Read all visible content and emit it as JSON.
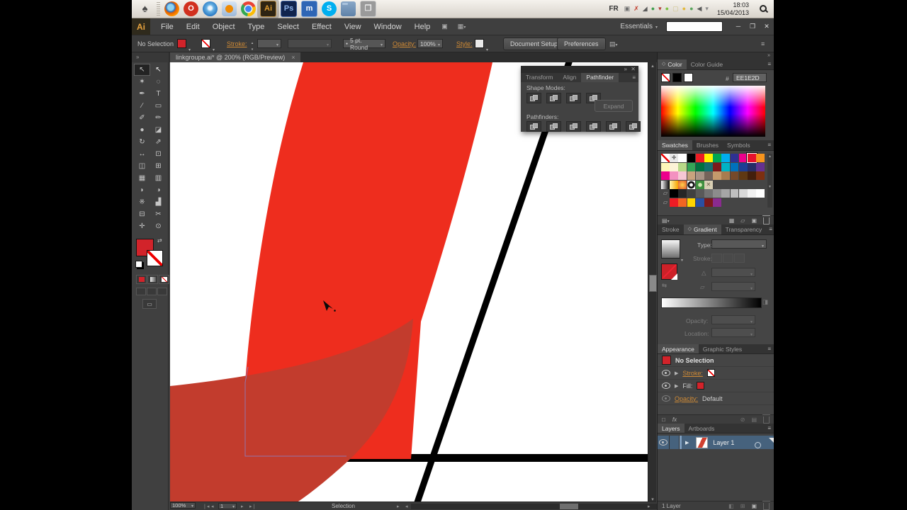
{
  "taskbar": {
    "language": "FR",
    "time": "18:03",
    "date": "15/04/2013",
    "apps": [
      {
        "name": "apple-menu-icon",
        "kind": "glyph",
        "label": "♠",
        "fg": "#4a4a4a"
      },
      {
        "name": "dock-separator",
        "kind": "sep"
      },
      {
        "name": "firefox-icon",
        "kind": "firefox"
      },
      {
        "name": "opera-icon",
        "kind": "opera",
        "label": "O",
        "fg": "#ffffff"
      },
      {
        "name": "safari-icon",
        "kind": "safari"
      },
      {
        "name": "media-player-icon",
        "kind": "player"
      },
      {
        "name": "chrome-icon",
        "kind": "chrome"
      },
      {
        "name": "illustrator-icon",
        "kind": "tile",
        "bg": "#2e2413",
        "border": "#b78a3e",
        "label": "Ai",
        "fg": "#e09c2f",
        "active": true
      },
      {
        "name": "photoshop-icon",
        "kind": "tile",
        "bg": "#11244d",
        "border": "#3e5f9e",
        "label": "Ps",
        "fg": "#8fb3e8"
      },
      {
        "name": "maxthon-icon",
        "kind": "tile",
        "bg": "#2f66b5",
        "border": "#7aa0d4",
        "label": "m",
        "fg": "#ffffff"
      },
      {
        "name": "skype-icon",
        "kind": "skype",
        "label": "S",
        "fg": "#ffffff"
      },
      {
        "name": "folder-icon",
        "kind": "folder"
      },
      {
        "name": "window-icon",
        "kind": "tile",
        "bg": "#9a9a9a",
        "border": "#c9c9c9",
        "label": "❐",
        "fg": "#f2f2f2"
      }
    ],
    "tray": [
      {
        "name": "window-tray-icon",
        "glyph": "▣",
        "color": "#6f6f6f"
      },
      {
        "name": "error-tray-icon",
        "glyph": "✗",
        "color": "#c23b2a"
      },
      {
        "name": "network-signal-icon",
        "glyph": "◢",
        "color": "#5a5a5a"
      },
      {
        "name": "globe-tray-icon",
        "glyph": "●",
        "color": "#3f9e4d"
      },
      {
        "name": "alert-tray-icon",
        "glyph": "▾",
        "color": "#b03a30"
      },
      {
        "name": "antivirus-tray-icon",
        "glyph": "●",
        "color": "#7ac143"
      },
      {
        "name": "notes-tray-icon",
        "glyph": "▢",
        "color": "#cfc489"
      },
      {
        "name": "status-tray-icon",
        "glyph": "●",
        "color": "#e3b93c"
      },
      {
        "name": "chat-tray-icon",
        "glyph": "●",
        "color": "#58a55c"
      },
      {
        "name": "volume-tray-icon",
        "glyph": "◀",
        "color": "#5a5a5a"
      },
      {
        "name": "tray-expand-icon",
        "glyph": "▾",
        "color": "#8a8a8a"
      }
    ]
  },
  "icons": {
    "minimize": "─",
    "restore": "❐",
    "close": "✕",
    "tab_close": "×",
    "panel_menu": "≡",
    "dock_collapse": "»",
    "float_collapse": "»",
    "bridge": "▣",
    "workspace_grid": "▦",
    "extra_options": "▤",
    "collapse_panel": "≡",
    "first": "❘◂",
    "prev": "◂",
    "next": "▸",
    "last": "▸❘",
    "status_next": "▸",
    "scroll_left": "◂",
    "scroll_right": "▸",
    "scroll_up": "▴",
    "scroll_down": "▾",
    "swap": "⇄",
    "brush_dot": "●",
    "hash": "#",
    "angle": "△",
    "aspect": "▱",
    "reverse": "⇆",
    "slider_end": "◨",
    "tab_icon": "◇",
    "library": "▤",
    "kinds": "▦",
    "group_folder": "▱",
    "new_item": "▣",
    "new_stroke": "□",
    "fx": "fx",
    "clear": "⊘",
    "duplicate": "▤",
    "clip_mask": "◧",
    "sublayer": "⊞",
    "expand_tri": "▶"
  },
  "menubar": {
    "logo": "Ai",
    "items": [
      "File",
      "Edit",
      "Object",
      "Type",
      "Select",
      "Effect",
      "View",
      "Window",
      "Help"
    ],
    "workspace": "Essentials",
    "search_value": ""
  },
  "controlbar": {
    "selection": "No Selection",
    "stroke_label": "Stroke:",
    "brush": "5 pt. Round",
    "opacity_label": "Opacity:",
    "opacity_value": "100%",
    "style_label": "Style:",
    "document_setup": "Document Setup",
    "preferences": "Preferences"
  },
  "document": {
    "tab": "linkgroupe.ai* @ 200% (RGB/Preview)"
  },
  "tools": [
    {
      "name": "selection-tool",
      "glyph": "↖",
      "selected": true
    },
    {
      "name": "direct-selection-tool",
      "glyph": "↖",
      "light": true
    },
    {
      "name": "magic-wand-tool",
      "glyph": "✶"
    },
    {
      "name": "lasso-tool",
      "glyph": "◌"
    },
    {
      "name": "pen-tool",
      "glyph": "✒"
    },
    {
      "name": "type-tool",
      "glyph": "T"
    },
    {
      "name": "line-segment-tool",
      "glyph": "∕"
    },
    {
      "name": "rectangle-tool",
      "glyph": "▭"
    },
    {
      "name": "paintbrush-tool",
      "glyph": "✐"
    },
    {
      "name": "pencil-tool",
      "glyph": "✏"
    },
    {
      "name": "blob-brush-tool",
      "glyph": "●"
    },
    {
      "name": "eraser-tool",
      "glyph": "◪"
    },
    {
      "name": "rotate-tool",
      "glyph": "↻"
    },
    {
      "name": "scale-tool",
      "glyph": "⇗"
    },
    {
      "name": "width-tool",
      "glyph": "↔"
    },
    {
      "name": "free-transform-tool",
      "glyph": "⊡"
    },
    {
      "name": "shape-builder-tool",
      "glyph": "◫"
    },
    {
      "name": "perspective-grid-tool",
      "glyph": "⊞"
    },
    {
      "name": "mesh-tool",
      "glyph": "▦"
    },
    {
      "name": "gradient-tool",
      "glyph": "▥"
    },
    {
      "name": "eyedropper-tool",
      "glyph": "◗"
    },
    {
      "name": "blend-tool",
      "glyph": "◑"
    },
    {
      "name": "symbol-sprayer-tool",
      "glyph": "※"
    },
    {
      "name": "column-graph-tool",
      "glyph": "▟"
    },
    {
      "name": "artboard-tool",
      "glyph": "⊟"
    },
    {
      "name": "slice-tool",
      "glyph": "✂"
    },
    {
      "name": "hand-tool",
      "glyph": "✛"
    },
    {
      "name": "zoom-tool",
      "glyph": "⊙"
    }
  ],
  "pathfinder_panel": {
    "tabs": [
      "Transform",
      "Align",
      "Pathfinder"
    ],
    "shape_modes_label": "Shape Modes:",
    "expand_label": "Expand",
    "pathfinders_label": "Pathfinders:",
    "shape_modes": [
      "unite",
      "minus-front",
      "intersect",
      "exclude"
    ],
    "pathfinders": [
      "divide",
      "trim",
      "merge",
      "crop",
      "outline",
      "minus-back"
    ]
  },
  "color_panel": {
    "tab_color": "Color",
    "tab_guide": "Color Guide",
    "hash": "#",
    "hex": "EE1E2D"
  },
  "swatches_panel": {
    "tab_swatches": "Swatches",
    "tab_brushes": "Brushes",
    "tab_symbols": "Symbols",
    "rows": [
      [
        "none",
        "reg",
        "#ffffff",
        "#000000",
        "#ed1c24",
        "#fff200",
        "#00a651",
        "#00aeef",
        "#2e3192",
        "#ec008c",
        "sel:#e8112d",
        "#f7941d"
      ],
      [
        "#fdf6b8",
        "#fcf3d6",
        "#b8d988",
        "#33a457",
        "#00713f",
        "#136f6e",
        "#7c1a1c",
        "#00b3c5",
        "#0071bc",
        "#1c3e94",
        "#262d66",
        "#65308f"
      ],
      [
        "#ec008c",
        "#f391c0",
        "#f7c7d4",
        "#c9a37e",
        "#a89385",
        "#75635a",
        "#c49a6c",
        "#a87c4f",
        "#75492a",
        "#5f3813",
        "#431f0c",
        "#7c2f10"
      ],
      [
        "grad-bw",
        "grad-gold",
        "grad-fire",
        "grad-ring",
        "pat-dot",
        "pat-x",
        "",
        "",
        "",
        "",
        "",
        ""
      ],
      [
        "folder",
        "#000000",
        "#262626",
        "#404040",
        "#595959",
        "#737373",
        "#8c8c8c",
        "#a6a6a6",
        "#bfbfbf",
        "#d9d9d9",
        "#f2f2f2",
        "#ffffff"
      ],
      [
        "folder",
        "#ed1c24",
        "#f26522",
        "#ffd400",
        "#2a4fa2",
        "#7c1a1c",
        "#8a2b8f",
        "",
        "",
        "",
        "",
        ""
      ]
    ]
  },
  "gradient_panel": {
    "tab_stroke": "Stroke",
    "tab_gradient": "Gradient",
    "tab_transparency": "Transparency",
    "type_label": "Type:",
    "stroke_label": "Stroke:",
    "opacity_label": "Opacity:",
    "location_label": "Location:"
  },
  "appearance_panel": {
    "tab_appearance": "Appearance",
    "tab_styles": "Graphic Styles",
    "selection": "No Selection",
    "stroke_label": "Stroke:",
    "fill_label": "Fill:",
    "opacity_label": "Opacity:",
    "opacity_value": "Default"
  },
  "layers_panel": {
    "tab_layers": "Layers",
    "tab_artboards": "Artboards",
    "layer": "Layer 1",
    "count": "1 Layer"
  },
  "statusbar": {
    "zoom": "100%",
    "artboard": "1",
    "status": "Selection"
  },
  "artwork": {
    "band_color": "#ee2d1e",
    "overlay_color": "#c23c2d",
    "line_color": "#000000",
    "selection_outline": "#8f7bb8"
  }
}
